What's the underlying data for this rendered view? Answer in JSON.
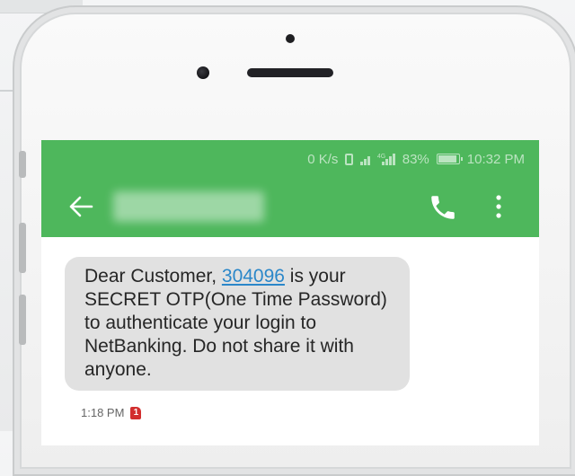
{
  "status_bar": {
    "speed": "0 K/s",
    "network_type": "4G",
    "battery": "83%",
    "time": "10:32 PM"
  },
  "app_bar": {
    "back_icon": "arrow-left-icon",
    "call_icon": "phone-icon",
    "menu_icon": "more-vert-icon",
    "contact_name_redacted": true
  },
  "message": {
    "text_before_otp": "Dear Customer, ",
    "otp": "304096",
    "text_after_otp": " is your SECRET OTP(One Time Password) to authenticate your login to NetBanking. Do not share it with anyone.",
    "time": "1:18 PM",
    "sim_badge": "1"
  },
  "colors": {
    "app_bar": "#4eb75c",
    "bubble": "#e1e1e1",
    "otp_link": "#2b87c9",
    "sim_badge": "#d22f2f"
  }
}
